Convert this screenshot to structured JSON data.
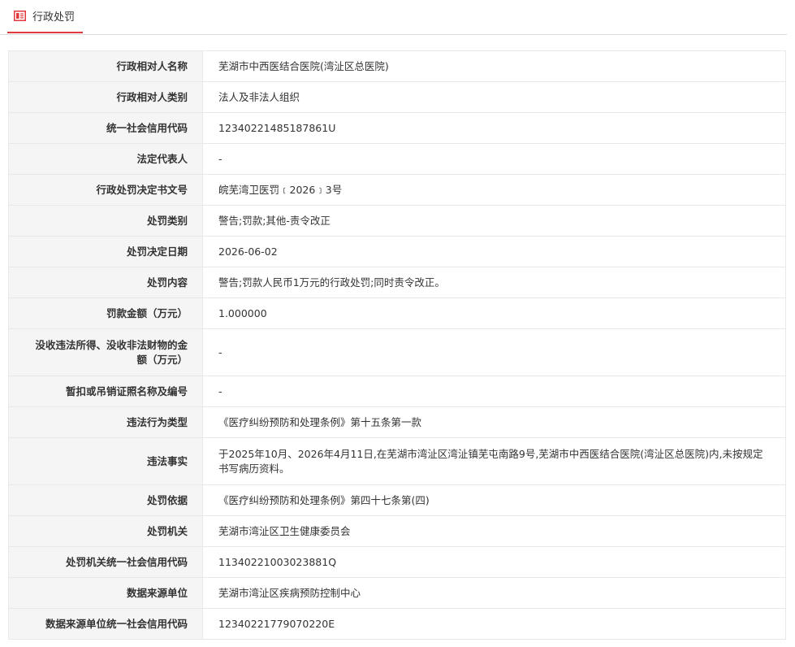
{
  "header": {
    "tab_title": "行政处罚",
    "tab_icon": "document-icon",
    "accent_color": "#e4393c"
  },
  "rows": [
    {
      "label": "行政相对人名称",
      "value": "芜湖市中西医结合医院(湾沚区总医院)"
    },
    {
      "label": "行政相对人类别",
      "value": "法人及非法人组织"
    },
    {
      "label": "统一社会信用代码",
      "value": "12340221485187861U"
    },
    {
      "label": "法定代表人",
      "value": "-"
    },
    {
      "label": "行政处罚决定书文号",
      "value": "皖芜湾卫医罚﹝2026﹞3号"
    },
    {
      "label": "处罚类别",
      "value": "警告;罚款;其他-责令改正"
    },
    {
      "label": "处罚决定日期",
      "value": "2026-06-02"
    },
    {
      "label": "处罚内容",
      "value": "警告;罚款人民币1万元的行政处罚;同时责令改正。"
    },
    {
      "label": "罚款金额（万元）",
      "value": "1.000000"
    },
    {
      "label": "没收违法所得、没收非法财物的金额（万元）",
      "value": "-"
    },
    {
      "label": "暂扣或吊销证照名称及编号",
      "value": "-"
    },
    {
      "label": "违法行为类型",
      "value": "《医疗纠纷预防和处理条例》第十五条第一款"
    },
    {
      "label": "违法事实",
      "value": "于2025年10月、2026年4月11日,在芜湖市湾沚区湾沚镇芜屯南路9号,芜湖市中西医结合医院(湾沚区总医院)内,未按规定书写病历资料。"
    },
    {
      "label": "处罚依据",
      "value": "《医疗纠纷预防和处理条例》第四十七条第(四)"
    },
    {
      "label": "处罚机关",
      "value": "芜湖市湾沚区卫生健康委员会"
    },
    {
      "label": "处罚机关统一社会信用代码",
      "value": "11340221003023881Q"
    },
    {
      "label": "数据来源单位",
      "value": "芜湖市湾沚区疾病预防控制中心"
    },
    {
      "label": "数据来源单位统一社会信用代码",
      "value": "12340221779070220E"
    }
  ]
}
